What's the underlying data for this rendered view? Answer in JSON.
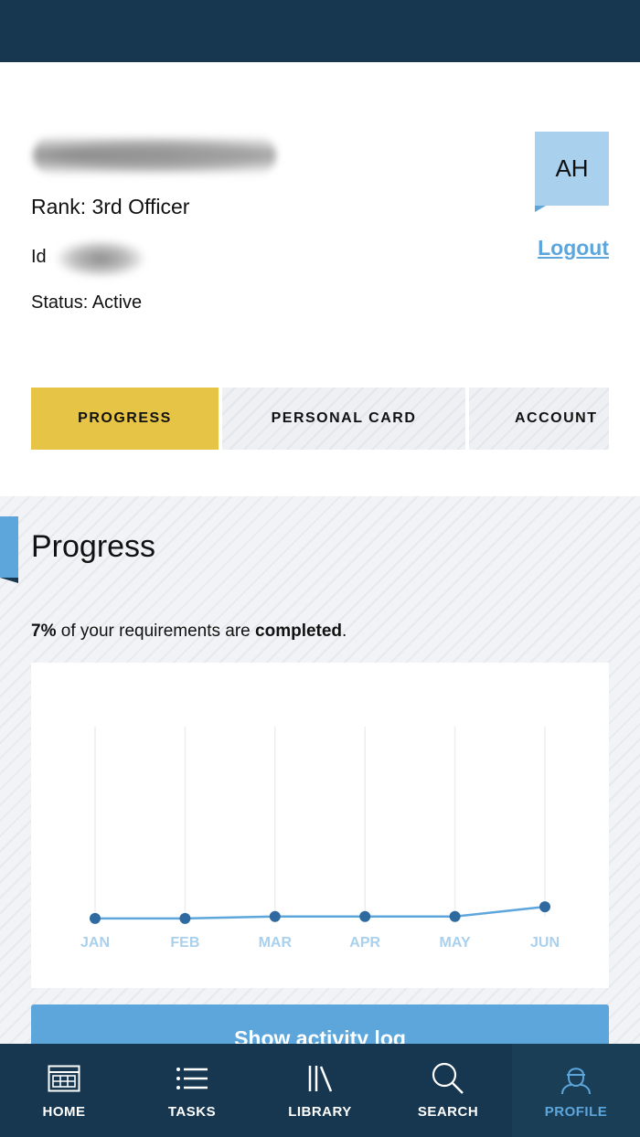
{
  "profile": {
    "rank": "Rank: 3rd Officer",
    "id_label": "Id",
    "status": "Status: Active",
    "avatar_initials": "AH",
    "logout_label": "Logout"
  },
  "tabs": [
    {
      "label": "PROGRESS",
      "active": true
    },
    {
      "label": "PERSONAL CARD",
      "active": false
    },
    {
      "label": "ACCOUNT",
      "active": false
    }
  ],
  "progress": {
    "title": "Progress",
    "percent": "7%",
    "text_middle": " of your requirements are ",
    "text_bold": "completed",
    "text_end": ".",
    "activity_button": "Show activity log"
  },
  "chart_data": {
    "type": "line",
    "categories": [
      "JAN",
      "FEB",
      "MAR",
      "APR",
      "MAY",
      "JUN"
    ],
    "series": [
      {
        "values": [
          1,
          1,
          2,
          2,
          2,
          7
        ]
      }
    ],
    "ylim": [
      0,
      100
    ],
    "grid": "vertical",
    "color": "#5ca6dc",
    "marker_color": "#2e6aa0",
    "label_color": "#a9d0ec"
  },
  "bottom_nav": [
    {
      "label": "HOME",
      "icon": "home-icon",
      "active": false
    },
    {
      "label": "TASKS",
      "icon": "tasks-icon",
      "active": false
    },
    {
      "label": "LIBRARY",
      "icon": "library-icon",
      "active": false
    },
    {
      "label": "SEARCH",
      "icon": "search-icon",
      "active": false
    },
    {
      "label": "PROFILE",
      "icon": "profile-icon",
      "active": true
    }
  ],
  "colors": {
    "header": "#16374f",
    "accent": "#5ca6dc",
    "tab_active": "#e6c446"
  }
}
